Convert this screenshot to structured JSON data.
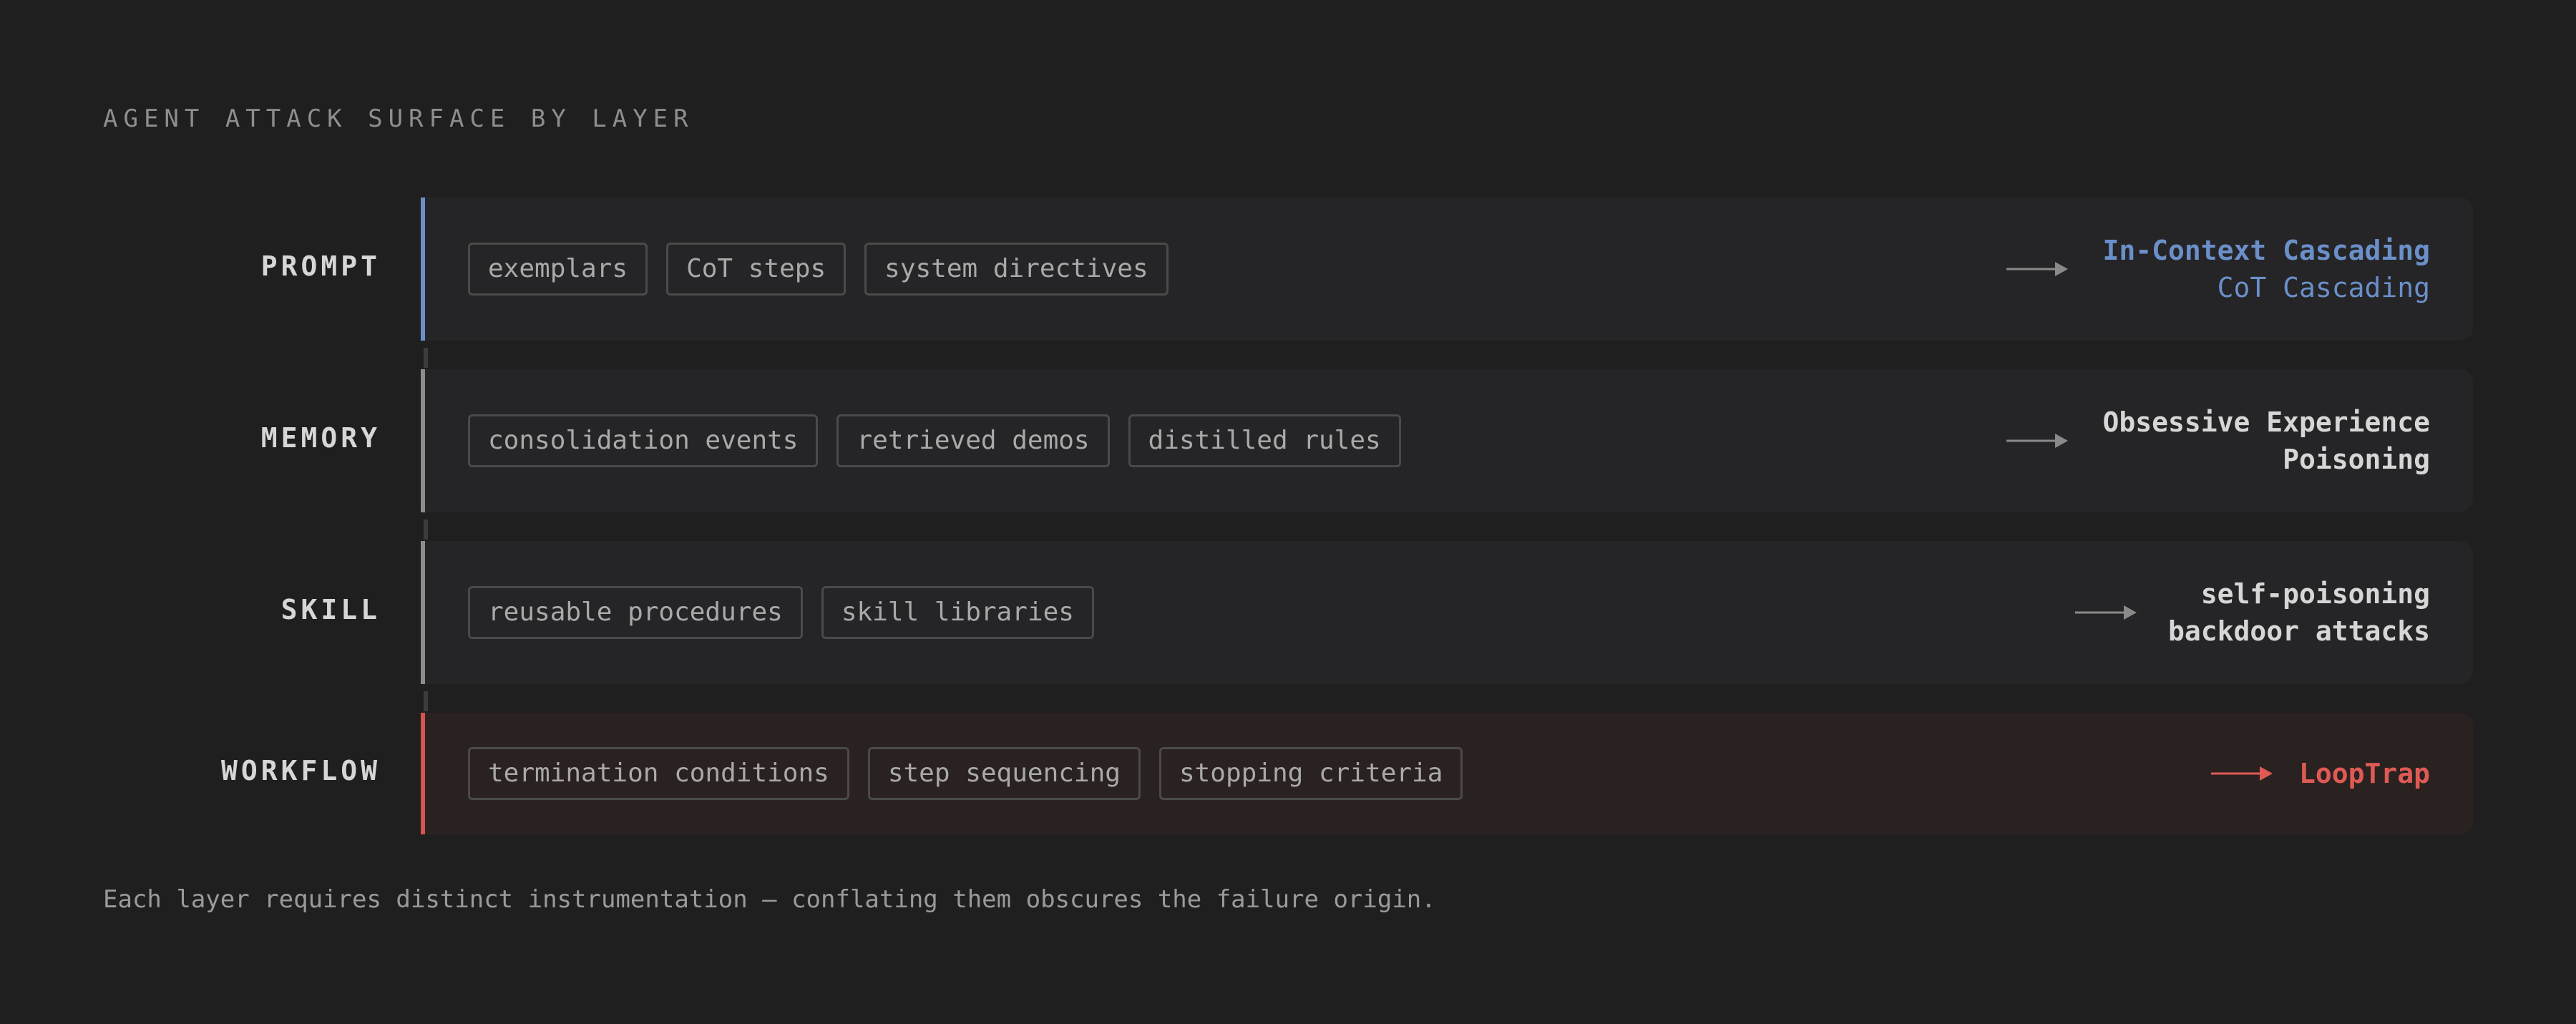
{
  "title": "AGENT ATTACK SURFACE BY LAYER",
  "layers": [
    {
      "label": "PROMPT",
      "chips": [
        "exemplars",
        "CoT steps",
        "system directives"
      ],
      "result_primary": "In-Context Cascading",
      "result_secondary": "CoT Cascading",
      "accent": "#6b8fc9",
      "result_color": "#6b8fc9",
      "arrow_color": "#8a8a8a"
    },
    {
      "label": "MEMORY",
      "chips": [
        "consolidation events",
        "retrieved demos",
        "distilled rules"
      ],
      "result_primary": "Obsessive Experience",
      "result_secondary": "Poisoning",
      "accent": "#8d8d8d",
      "result_color": "#d6d6d6",
      "arrow_color": "#8a8a8a"
    },
    {
      "label": "SKILL",
      "chips": [
        "reusable procedures",
        "skill libraries"
      ],
      "result_primary": "self-poisoning",
      "result_secondary": "backdoor attacks",
      "accent": "#8d8d8d",
      "result_color": "#d6d6d6",
      "arrow_color": "#8a8a8a"
    },
    {
      "label": "WORKFLOW",
      "chips": [
        "termination conditions",
        "step sequencing",
        "stopping criteria"
      ],
      "result_primary": "LoopTrap",
      "result_secondary": "",
      "accent": "#d9534f",
      "result_color": "#e05a55",
      "arrow_color": "#e05a55"
    }
  ],
  "footnote": "Each layer requires distinct instrumentation — conflating them obscures the failure origin."
}
